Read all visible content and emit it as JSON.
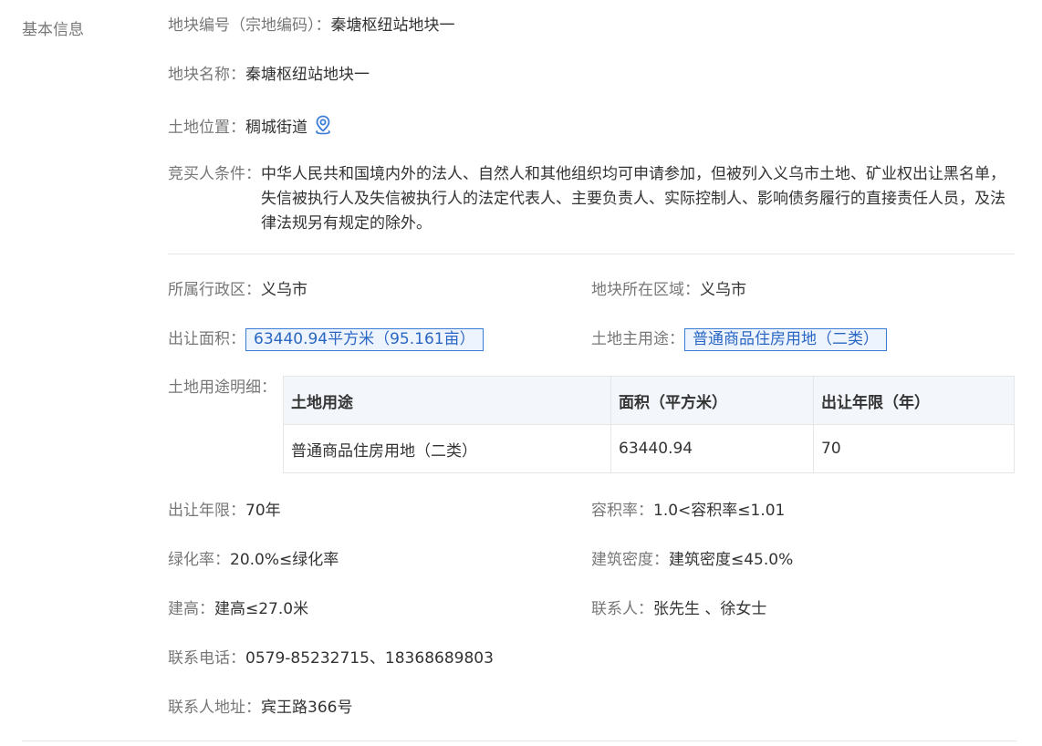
{
  "section_title": "基本信息",
  "fields": {
    "parcel_code": {
      "label": "地块编号（宗地编码）：",
      "value": "秦塘枢纽站地块一"
    },
    "parcel_name": {
      "label": "地块名称：",
      "value": "秦塘枢纽站地块一"
    },
    "location": {
      "label": "土地位置：",
      "value": "稠城街道",
      "icon": "map-pin-icon"
    },
    "bidder_conditions": {
      "label": "竞买人条件：",
      "value": "中华人民共和国境内外的法人、自然人和其他组织均可申请参加，但被列入义乌市土地、矿业权出让黑名单，失信被执行人及失信被执行人的法定代表人、主要负责人、实际控制人、影响债务履行的直接责任人员，及法律法规另有规定的除外。"
    },
    "admin_district": {
      "label": "所属行政区：",
      "value": "义乌市"
    },
    "parcel_area_region": {
      "label": "地块所在区域：",
      "value": "义乌市"
    },
    "transfer_area": {
      "label": "出让面积：",
      "value": "63440.94平方米（95.161亩）"
    },
    "main_use": {
      "label": "土地主用途：",
      "value": "普通商品住房用地（二类）"
    },
    "use_detail_label": "土地用途明细：",
    "transfer_term": {
      "label": "出让年限：",
      "value": "70年"
    },
    "plot_ratio": {
      "label": "容积率：",
      "value": "1.0<容积率≤1.01"
    },
    "green_ratio": {
      "label": "绿化率：",
      "value": "20.0%≤绿化率"
    },
    "building_density": {
      "label": "建筑密度：",
      "value": "建筑密度≤45.0%"
    },
    "building_height": {
      "label": "建高：",
      "value": "建高≤27.0米"
    },
    "contact_person": {
      "label": "联系人：",
      "value": "张先生 、徐女士"
    },
    "contact_phone": {
      "label": "联系电话：",
      "value": "0579-85232715、18368689803"
    },
    "contact_address": {
      "label": "联系人地址：",
      "value": "宾王路366号"
    }
  },
  "use_table": {
    "headers": [
      "土地用途",
      "面积（平方米）",
      "出让年限（年）"
    ],
    "rows": [
      [
        "普通商品住房用地（二类）",
        "63440.94",
        "70"
      ]
    ]
  },
  "colors": {
    "accent": "#2a67c4",
    "label": "#777777",
    "text": "#333333",
    "border": "#e6e6e6"
  }
}
